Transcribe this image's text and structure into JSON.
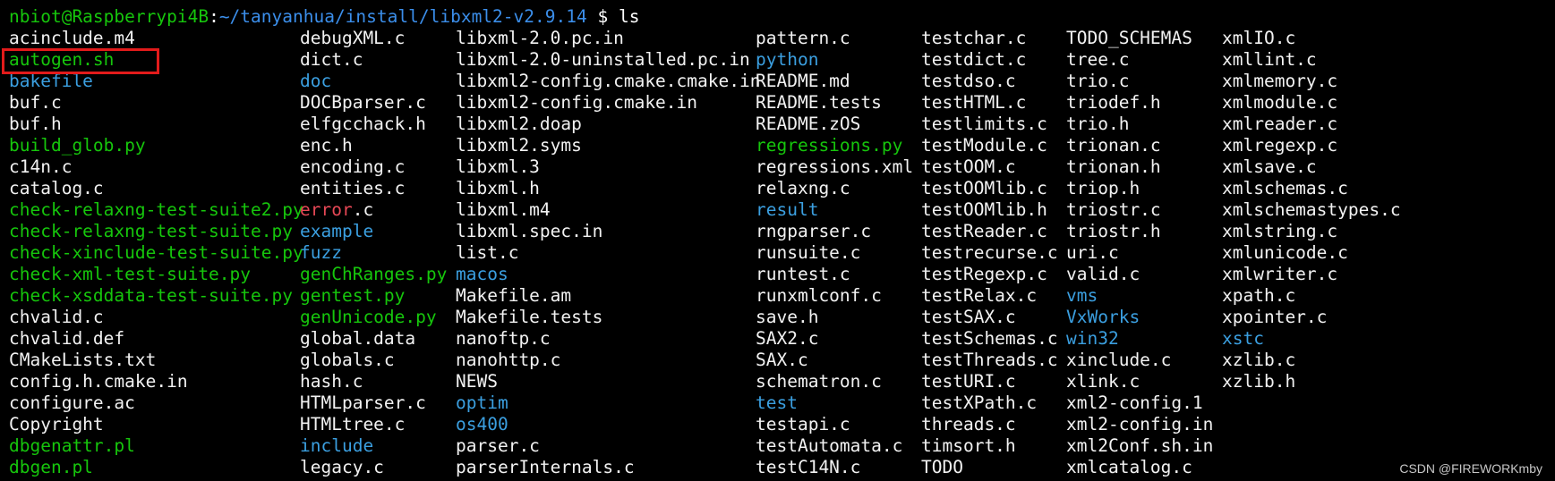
{
  "prompt": {
    "user_host": "nbiot@Raspberrypi4B",
    "separator": ":",
    "path": "~/tanyanhua/install/libxml2-v2.9.14",
    "symbol": " $ ",
    "command": "ls"
  },
  "columns": [
    [
      {
        "name": "acinclude.m4",
        "type": "file"
      },
      {
        "name": "autogen.sh",
        "type": "exec"
      },
      {
        "name": "bakefile",
        "type": "dir"
      },
      {
        "name": "buf.c",
        "type": "file"
      },
      {
        "name": "buf.h",
        "type": "file"
      },
      {
        "name": "build_glob.py",
        "type": "exec"
      },
      {
        "name": "c14n.c",
        "type": "file"
      },
      {
        "name": "catalog.c",
        "type": "file"
      },
      {
        "name": "check-relaxng-test-suite2.py",
        "type": "exec"
      },
      {
        "name": "check-relaxng-test-suite.py",
        "type": "exec"
      },
      {
        "name": "check-xinclude-test-suite.py",
        "type": "exec"
      },
      {
        "name": "check-xml-test-suite.py",
        "type": "exec"
      },
      {
        "name": "check-xsddata-test-suite.py",
        "type": "exec"
      },
      {
        "name": "chvalid.c",
        "type": "file"
      },
      {
        "name": "chvalid.def",
        "type": "file"
      },
      {
        "name": "CMakeLists.txt",
        "type": "file"
      },
      {
        "name": "config.h.cmake.in",
        "type": "file"
      },
      {
        "name": "configure.ac",
        "type": "file"
      },
      {
        "name": "Copyright",
        "type": "file"
      },
      {
        "name": "dbgenattr.pl",
        "type": "exec"
      },
      {
        "name": "dbgen.pl",
        "type": "exec"
      }
    ],
    [
      {
        "name": "debugXML.c",
        "type": "file"
      },
      {
        "name": "dict.c",
        "type": "file"
      },
      {
        "name": "doc",
        "type": "dir"
      },
      {
        "name": "DOCBparser.c",
        "type": "file"
      },
      {
        "name": "elfgcchack.h",
        "type": "file"
      },
      {
        "name": "enc.h",
        "type": "file"
      },
      {
        "name": "encoding.c",
        "type": "file"
      },
      {
        "name": "entities.c",
        "type": "file"
      },
      {
        "name": "error",
        "type": "broken",
        "suffix": ".c"
      },
      {
        "name": "example",
        "type": "dir"
      },
      {
        "name": "fuzz",
        "type": "dir"
      },
      {
        "name": "genChRanges.py",
        "type": "exec"
      },
      {
        "name": "gentest.py",
        "type": "exec"
      },
      {
        "name": "genUnicode.py",
        "type": "exec"
      },
      {
        "name": "global.data",
        "type": "file"
      },
      {
        "name": "globals.c",
        "type": "file"
      },
      {
        "name": "hash.c",
        "type": "file"
      },
      {
        "name": "HTMLparser.c",
        "type": "file"
      },
      {
        "name": "HTMLtree.c",
        "type": "file"
      },
      {
        "name": "include",
        "type": "dir"
      },
      {
        "name": "legacy.c",
        "type": "file"
      }
    ],
    [
      {
        "name": "libxml-2.0.pc.in",
        "type": "file"
      },
      {
        "name": "libxml-2.0-uninstalled.pc.in",
        "type": "file"
      },
      {
        "name": "libxml2-config.cmake.cmake.in",
        "type": "file"
      },
      {
        "name": "libxml2-config.cmake.in",
        "type": "file"
      },
      {
        "name": "libxml2.doap",
        "type": "file"
      },
      {
        "name": "libxml2.syms",
        "type": "file"
      },
      {
        "name": "libxml.3",
        "type": "file"
      },
      {
        "name": "libxml.h",
        "type": "file"
      },
      {
        "name": "libxml.m4",
        "type": "file"
      },
      {
        "name": "libxml.spec.in",
        "type": "file"
      },
      {
        "name": "list.c",
        "type": "file"
      },
      {
        "name": "macos",
        "type": "dir"
      },
      {
        "name": "Makefile.am",
        "type": "file"
      },
      {
        "name": "Makefile.tests",
        "type": "file"
      },
      {
        "name": "nanoftp.c",
        "type": "file"
      },
      {
        "name": "nanohttp.c",
        "type": "file"
      },
      {
        "name": "NEWS",
        "type": "file"
      },
      {
        "name": "optim",
        "type": "dir"
      },
      {
        "name": "os400",
        "type": "dir"
      },
      {
        "name": "parser.c",
        "type": "file"
      },
      {
        "name": "parserInternals.c",
        "type": "file"
      }
    ],
    [
      {
        "name": "pattern.c",
        "type": "file"
      },
      {
        "name": "python",
        "type": "dir"
      },
      {
        "name": "README.md",
        "type": "file"
      },
      {
        "name": "README.tests",
        "type": "file"
      },
      {
        "name": "README.zOS",
        "type": "file"
      },
      {
        "name": "regressions.py",
        "type": "exec"
      },
      {
        "name": "regressions.xml",
        "type": "file"
      },
      {
        "name": "relaxng.c",
        "type": "file"
      },
      {
        "name": "result",
        "type": "dir"
      },
      {
        "name": "rngparser.c",
        "type": "file"
      },
      {
        "name": "runsuite.c",
        "type": "file"
      },
      {
        "name": "runtest.c",
        "type": "file"
      },
      {
        "name": "runxmlconf.c",
        "type": "file"
      },
      {
        "name": "save.h",
        "type": "file"
      },
      {
        "name": "SAX2.c",
        "type": "file"
      },
      {
        "name": "SAX.c",
        "type": "file"
      },
      {
        "name": "schematron.c",
        "type": "file"
      },
      {
        "name": "test",
        "type": "dir"
      },
      {
        "name": "testapi.c",
        "type": "file"
      },
      {
        "name": "testAutomata.c",
        "type": "file"
      },
      {
        "name": "testC14N.c",
        "type": "file"
      }
    ],
    [
      {
        "name": "testchar.c",
        "type": "file"
      },
      {
        "name": "testdict.c",
        "type": "file"
      },
      {
        "name": "testdso.c",
        "type": "file"
      },
      {
        "name": "testHTML.c",
        "type": "file"
      },
      {
        "name": "testlimits.c",
        "type": "file"
      },
      {
        "name": "testModule.c",
        "type": "file"
      },
      {
        "name": "testOOM.c",
        "type": "file"
      },
      {
        "name": "testOOMlib.c",
        "type": "file"
      },
      {
        "name": "testOOMlib.h",
        "type": "file"
      },
      {
        "name": "testReader.c",
        "type": "file"
      },
      {
        "name": "testrecurse.c",
        "type": "file"
      },
      {
        "name": "testRegexp.c",
        "type": "file"
      },
      {
        "name": "testRelax.c",
        "type": "file"
      },
      {
        "name": "testSAX.c",
        "type": "file"
      },
      {
        "name": "testSchemas.c",
        "type": "file"
      },
      {
        "name": "testThreads.c",
        "type": "file"
      },
      {
        "name": "testURI.c",
        "type": "file"
      },
      {
        "name": "testXPath.c",
        "type": "file"
      },
      {
        "name": "threads.c",
        "type": "file"
      },
      {
        "name": "timsort.h",
        "type": "file"
      },
      {
        "name": "TODO",
        "type": "file"
      }
    ],
    [
      {
        "name": "TODO_SCHEMAS",
        "type": "file"
      },
      {
        "name": "tree.c",
        "type": "file"
      },
      {
        "name": "trio.c",
        "type": "file"
      },
      {
        "name": "triodef.h",
        "type": "file"
      },
      {
        "name": "trio.h",
        "type": "file"
      },
      {
        "name": "trionan.c",
        "type": "file"
      },
      {
        "name": "trionan.h",
        "type": "file"
      },
      {
        "name": "triop.h",
        "type": "file"
      },
      {
        "name": "triostr.c",
        "type": "file"
      },
      {
        "name": "triostr.h",
        "type": "file"
      },
      {
        "name": "uri.c",
        "type": "file"
      },
      {
        "name": "valid.c",
        "type": "file"
      },
      {
        "name": "vms",
        "type": "dir"
      },
      {
        "name": "VxWorks",
        "type": "dir"
      },
      {
        "name": "win32",
        "type": "dir"
      },
      {
        "name": "xinclude.c",
        "type": "file"
      },
      {
        "name": "xlink.c",
        "type": "file"
      },
      {
        "name": "xml2-config.1",
        "type": "file"
      },
      {
        "name": "xml2-config.in",
        "type": "file"
      },
      {
        "name": "xml2Conf.sh.in",
        "type": "file"
      },
      {
        "name": "xmlcatalog.c",
        "type": "file"
      }
    ],
    [
      {
        "name": "xmlIO.c",
        "type": "file"
      },
      {
        "name": "xmllint.c",
        "type": "file"
      },
      {
        "name": "xmlmemory.c",
        "type": "file"
      },
      {
        "name": "xmlmodule.c",
        "type": "file"
      },
      {
        "name": "xmlreader.c",
        "type": "file"
      },
      {
        "name": "xmlregexp.c",
        "type": "file"
      },
      {
        "name": "xmlsave.c",
        "type": "file"
      },
      {
        "name": "xmlschemas.c",
        "type": "file"
      },
      {
        "name": "xmlschemastypes.c",
        "type": "file"
      },
      {
        "name": "xmlstring.c",
        "type": "file"
      },
      {
        "name": "xmlunicode.c",
        "type": "file"
      },
      {
        "name": "xmlwriter.c",
        "type": "file"
      },
      {
        "name": "xpath.c",
        "type": "file"
      },
      {
        "name": "xpointer.c",
        "type": "file"
      },
      {
        "name": "xstc",
        "type": "dir"
      },
      {
        "name": "xzlib.c",
        "type": "file"
      },
      {
        "name": "xzlib.h",
        "type": "file"
      }
    ]
  ],
  "watermark": "CSDN @FIREWORKmby",
  "colors": {
    "background": "#000000",
    "file": "#f2f2f2",
    "exec": "#16c60c",
    "dir": "#3b9fe0",
    "broken": "#e74856",
    "highlight_box": "#e21b1b"
  }
}
